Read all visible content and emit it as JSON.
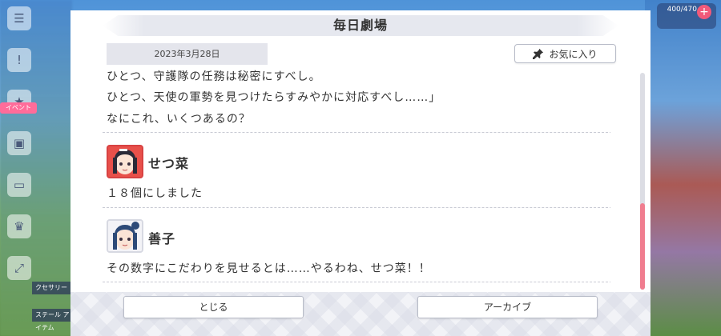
{
  "background": {
    "side_badge": "イベント",
    "side_labels": [
      "クセサリー",
      "ステール アイテム"
    ],
    "currency": "400/470"
  },
  "dialog": {
    "title": "毎日劇場",
    "date": "2023年3月28日",
    "favorite_label": "お気に入り",
    "lines": [
      {
        "text": "ひとつ、守護隊の任務は秘密にすべし。"
      },
      {
        "text": "ひとつ、天使の軍勢を見つけたらすみやかに対応すべし……」"
      },
      {
        "text": "なにこれ、いくつあるの？"
      }
    ],
    "entries": [
      {
        "speaker": "せつ菜",
        "text": "１８個にしました"
      },
      {
        "speaker": "善子",
        "text": "その数字にこだわりを見せるとは……やるわね、せつ菜！！"
      }
    ],
    "close_label": "とじる",
    "archive_label": "アーカイブ"
  },
  "colors": {
    "scroll_thumb": "#f07d8f",
    "accent_red": "#e8504a"
  },
  "scroll": {
    "position_fraction": 0.6
  }
}
